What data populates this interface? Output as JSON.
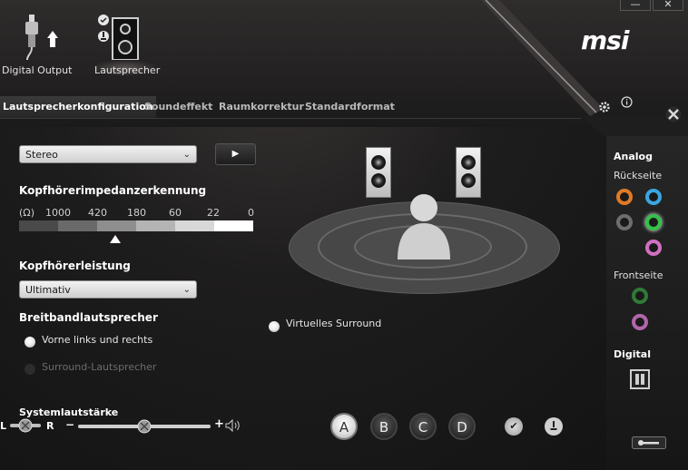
{
  "window": {
    "minimize_glyph": "—",
    "close_glyph": "✕"
  },
  "brand": {
    "logo": "msi"
  },
  "devices": [
    {
      "label": "Digital Output",
      "icon": "digital-output-plug-icon"
    },
    {
      "label": "Lautsprecher",
      "icon": "speaker-icon"
    }
  ],
  "tabs": [
    {
      "label": "Lautsprecherkonfiguration",
      "active": true
    },
    {
      "label": "Soundeffekt",
      "active": false
    },
    {
      "label": "Raumkorrektur",
      "active": false
    },
    {
      "label": "Standardformat",
      "active": false
    }
  ],
  "config": {
    "speaker_mode": "Stereo",
    "play_glyph": "▶",
    "impedance_heading": "Kopfhörerimpedanzerkennung",
    "impedance_unit": "(Ω)",
    "impedance_values": [
      "1000",
      "420",
      "180",
      "60",
      "22",
      "0"
    ],
    "impedance_selected_index": 2,
    "headphone_power_heading": "Kopfhörerleistung",
    "headphone_power": "Ultimativ",
    "fullrange_heading": "Breitbandlautsprecher",
    "fullrange_options": [
      {
        "label": "Vorne links und rechts",
        "selected": true,
        "enabled": true
      },
      {
        "label": "Surround-Lautsprecher",
        "selected": false,
        "enabled": false
      }
    ],
    "virtual_surround_label": "Virtuelles Surround"
  },
  "volume": {
    "heading": "Systemlautstärke",
    "left": "L",
    "right": "R",
    "minus": "−",
    "plus": "+",
    "level": 0.5
  },
  "profiles": [
    "A",
    "B",
    "C",
    "D"
  ],
  "active_profile": "A",
  "right_panel": {
    "analog_heading": "Analog",
    "back_label": "Rückseite",
    "front_label": "Frontseite",
    "digital_heading": "Digital"
  },
  "colors": {
    "jack_orange": "#e07a26",
    "jack_blue": "#3aa6e0",
    "jack_gray": "#6e6e6e",
    "jack_green": "#36c04a",
    "jack_pink": "#d070c0"
  }
}
